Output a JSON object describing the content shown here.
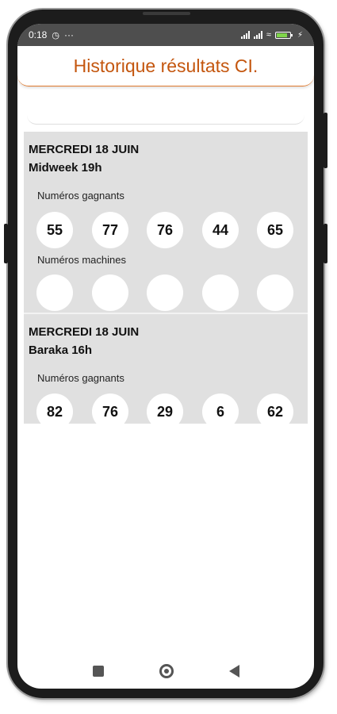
{
  "status_bar": {
    "time": "0:18",
    "more": "···"
  },
  "header": {
    "title": "Historique résultats CI."
  },
  "results": [
    {
      "date": "MERCREDI 18 JUIN",
      "title": "Midweek 19h",
      "winning_label": "Numéros gagnants",
      "winning": [
        "55",
        "77",
        "76",
        "44",
        "65"
      ],
      "machine_label": "Numéros machines",
      "machine": [
        "",
        "",
        "",
        "",
        ""
      ]
    },
    {
      "date": "MERCREDI 18 JUIN",
      "title": "Baraka 16h",
      "winning_label": "Numéros gagnants",
      "winning": [
        "82",
        "76",
        "29",
        "6",
        "62"
      ]
    }
  ],
  "colors": {
    "accent": "#c4560e",
    "card_bg": "#e0e0e0",
    "status_bg": "#4e4e4e"
  }
}
